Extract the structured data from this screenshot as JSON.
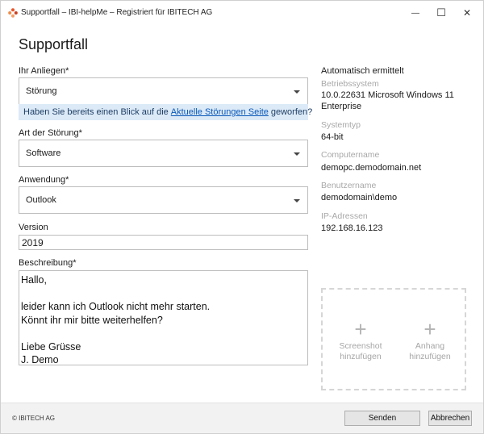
{
  "window": {
    "title": "Supportfall – IBI-helpMe – Registriert für IBITECH AG",
    "minimize_glyph": "—",
    "maximize_glyph": "☐",
    "close_glyph": "✕"
  },
  "heading": "Supportfall",
  "form": {
    "anliegen_label": "Ihr Anliegen*",
    "anliegen_value": "Störung",
    "info_prefix": "Haben Sie bereits einen Blick auf die",
    "info_link": "Aktuelle Störungen Seite",
    "info_suffix": "geworfen?",
    "art_label": "Art der Störung*",
    "art_value": "Software",
    "anwendung_label": "Anwendung*",
    "anwendung_value": "Outlook",
    "version_label": "Version",
    "version_value": "2019",
    "beschreibung_label": "Beschreibung*",
    "beschreibung_value": "Hallo,\n\nleider kann ich Outlook nicht mehr starten.\nKönnt ihr mir bitte weiterhelfen?\n\nLiebe Grüsse\nJ. Demo"
  },
  "auto": {
    "title": "Automatisch ermittelt",
    "betriebssystem_key": "Betriebssystem",
    "betriebssystem_val": "10.0.22631 Microsoft Windows 11 Enterprise",
    "systemtyp_key": "Systemtyp",
    "systemtyp_val": "64-bit",
    "computername_key": "Computername",
    "computername_val": "demopc.demodomain.net",
    "benutzername_key": "Benutzername",
    "benutzername_val": "demodomain\\demo",
    "ip_key": "IP-Adressen",
    "ip_val": "192.168.16.123"
  },
  "attachments": {
    "plus_glyph": "+",
    "screenshot_line1": "Screenshot",
    "screenshot_line2": "hinzufügen",
    "anhang_line1": "Anhang",
    "anhang_line2": "hinzufügen"
  },
  "footer": {
    "copyright": "© IBITECH AG",
    "send_label": "Senden",
    "cancel_label": "Abbrechen"
  },
  "colors": {
    "info_bar": "#dceaf7",
    "link": "#0a58b8",
    "logo_orange": "#e8552b"
  }
}
